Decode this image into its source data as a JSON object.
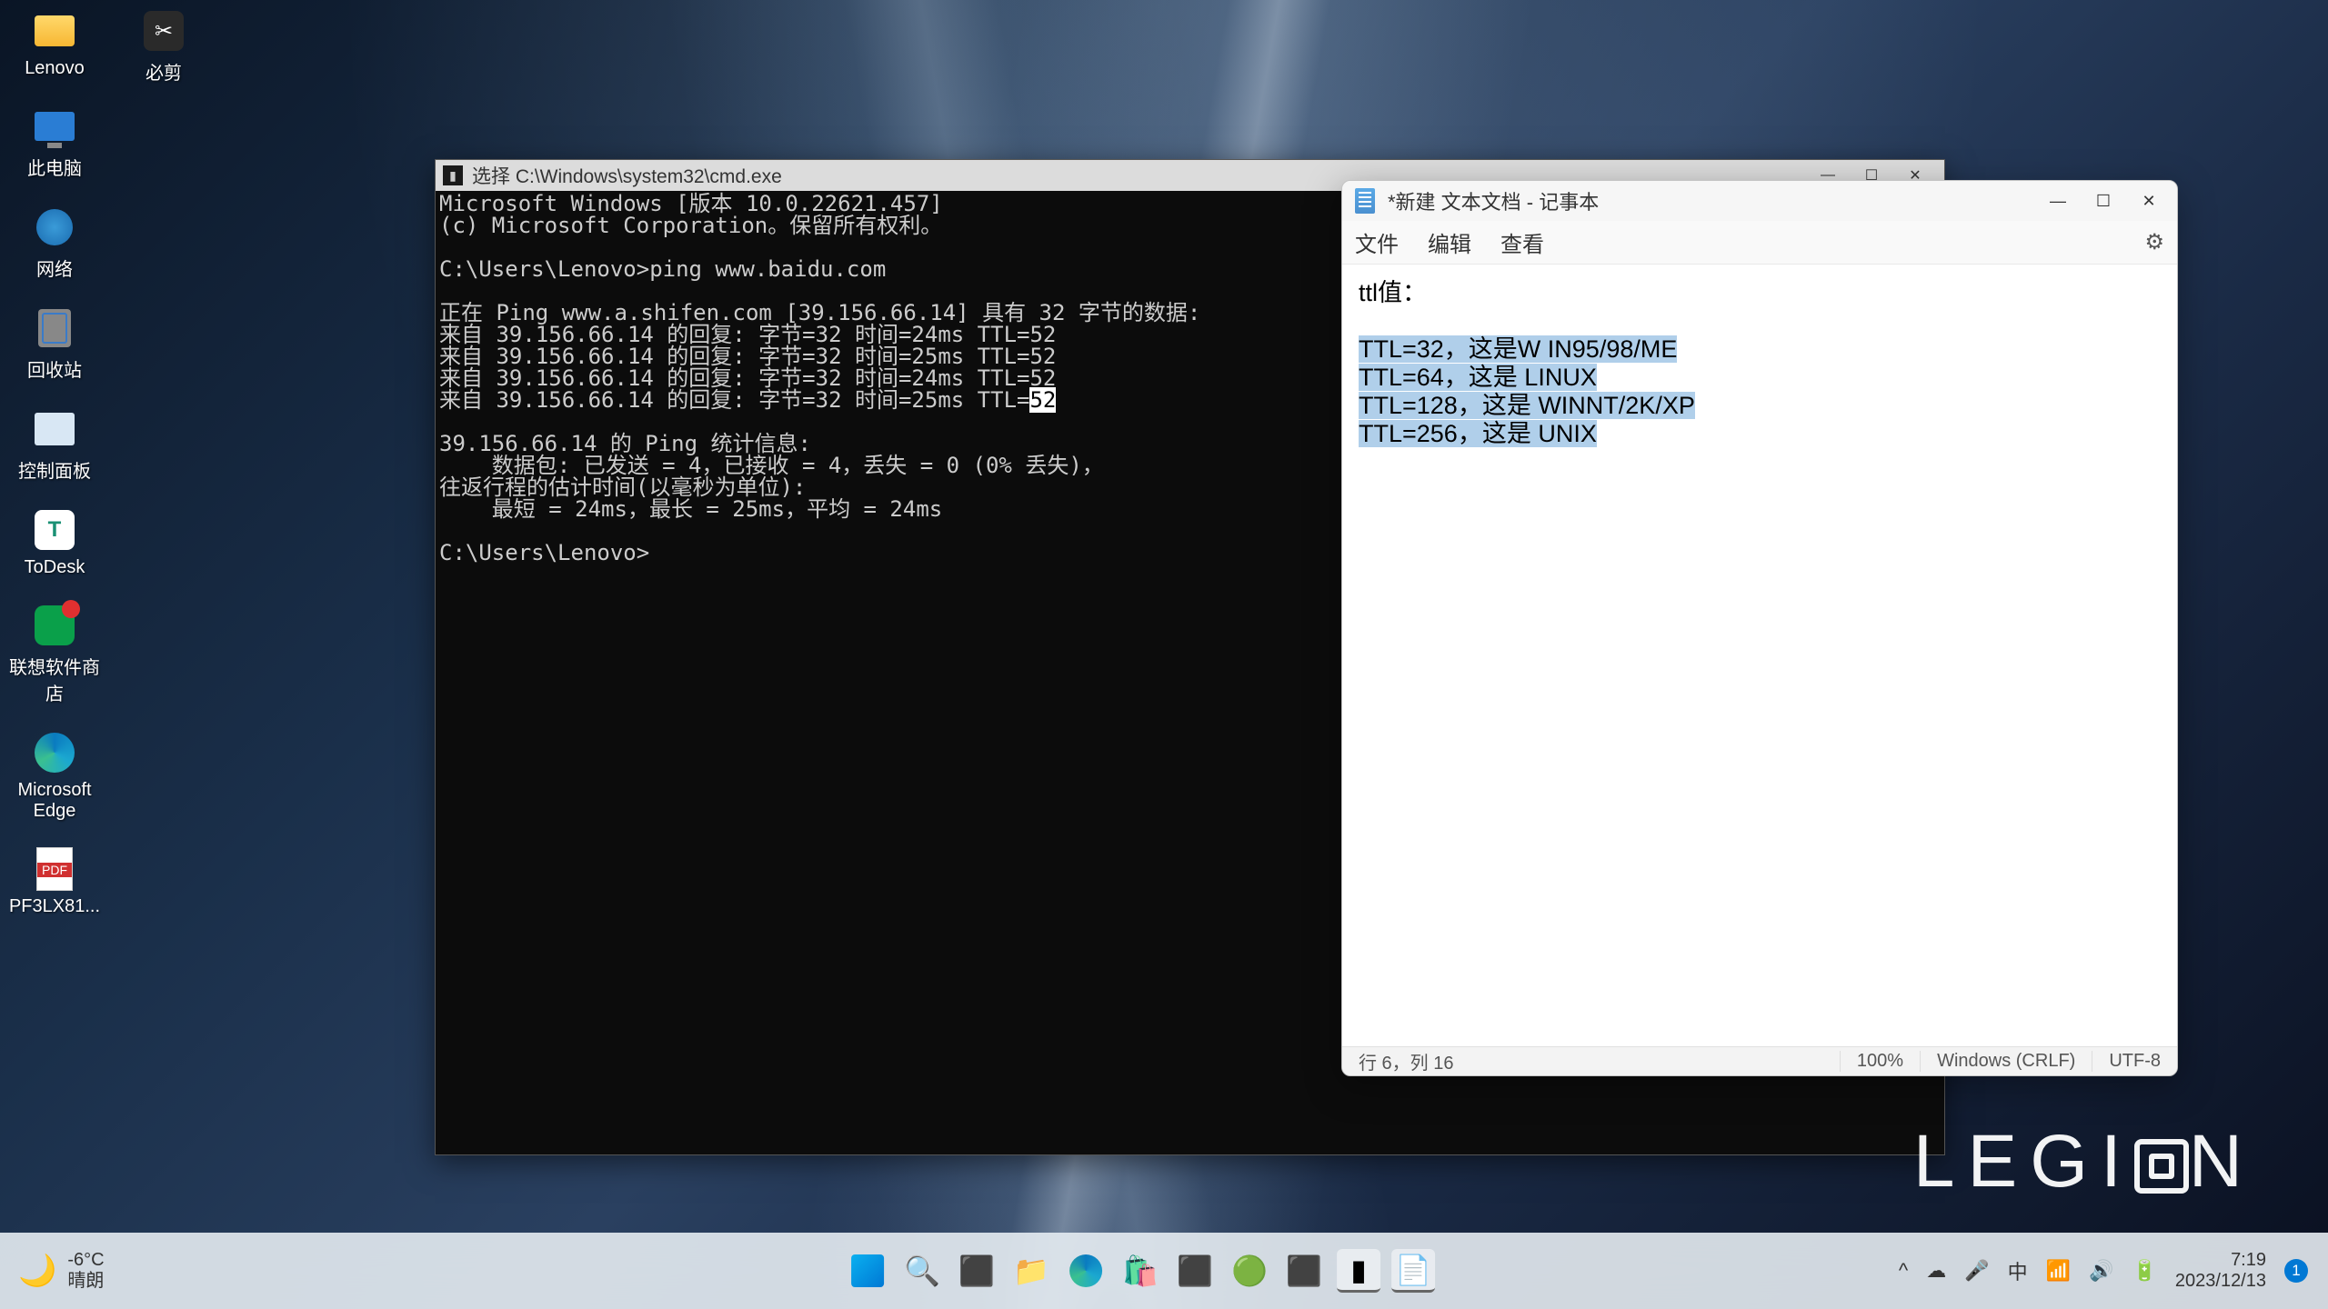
{
  "desktop_icons": {
    "lenovo": "Lenovo",
    "bijian": "必剪",
    "this_pc": "此电脑",
    "network": "网络",
    "recycle": "回收站",
    "control_panel": "控制面板",
    "todesk": "ToDesk",
    "lenovo_store": "联想软件商店",
    "edge": "Microsoft Edge",
    "pdf": "PF3LX81..."
  },
  "cmd": {
    "title": "选择 C:\\Windows\\system32\\cmd.exe",
    "line1": "Microsoft Windows [版本 10.0.22621.457]",
    "line2": "(c) Microsoft Corporation。保留所有权利。",
    "line3": "C:\\Users\\Lenovo>ping www.baidu.com",
    "line4": "正在 Ping www.a.shifen.com [39.156.66.14] 具有 32 字节的数据:",
    "line5": "来自 39.156.66.14 的回复: 字节=32 时间=24ms TTL=52",
    "line6": "来自 39.156.66.14 的回复: 字节=32 时间=25ms TTL=52",
    "line7": "来自 39.156.66.14 的回复: 字节=32 时间=24ms TTL=52",
    "line8a": "来自 39.156.66.14 的回复: 字节=32 时间=25ms TTL=",
    "line8b": "52",
    "line9": "39.156.66.14 的 Ping 统计信息:",
    "line10": "    数据包: 已发送 = 4，已接收 = 4，丢失 = 0 (0% 丢失)，",
    "line11": "往返行程的估计时间(以毫秒为单位):",
    "line12": "    最短 = 24ms，最长 = 25ms，平均 = 24ms",
    "line13": "C:\\Users\\Lenovo>"
  },
  "notepad": {
    "title": "*新建 文本文档 - 记事本",
    "menu_file": "文件",
    "menu_edit": "编辑",
    "menu_view": "查看",
    "heading": "ttl值：",
    "l1": "TTL=32，这是W IN95/98/ME ",
    "l2": "TTL=64，这是 LINUX ",
    "l3": "TTL=128，这是 WINNT/2K/XP ",
    "l4": "TTL=256，这是 UNIX",
    "status_pos": "行 6，列 16",
    "status_zoom": "100%",
    "status_eol": "Windows (CRLF)",
    "status_enc": "UTF-8"
  },
  "taskbar": {
    "temp": "-6°C",
    "weather": "晴朗",
    "ime": "中",
    "time": "7:19",
    "date": "2023/12/13",
    "notif_count": "1"
  },
  "legion": "LEGI  N"
}
